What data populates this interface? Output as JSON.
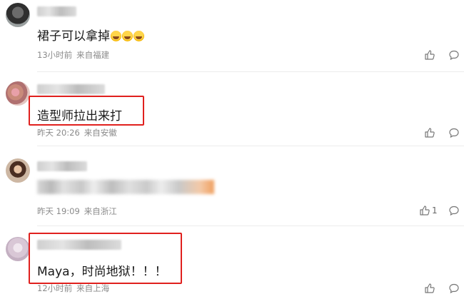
{
  "comments": [
    {
      "text": "裙子可以拿掉",
      "emojis": [
        "laughing-crying-emoji",
        "laughing-crying-emoji",
        "laughing-crying-emoji"
      ],
      "time": "13小时前",
      "location": "来自福建",
      "likes": ""
    },
    {
      "text": "造型师拉出来打",
      "time": "昨天 20:26",
      "location": "来自安徽",
      "likes": ""
    },
    {
      "text": "",
      "time": "昨天 19:09",
      "location": "来自浙江",
      "likes": "1"
    },
    {
      "text": "Maya，时尚地狱！！！",
      "time": "12小时前",
      "location": "来自上海",
      "likes": ""
    }
  ],
  "icons": {
    "like": "thumbs-up-icon",
    "reply": "comment-bubble-icon"
  },
  "colors": {
    "highlight": "#e0201e",
    "meta": "#8a8a8a"
  }
}
